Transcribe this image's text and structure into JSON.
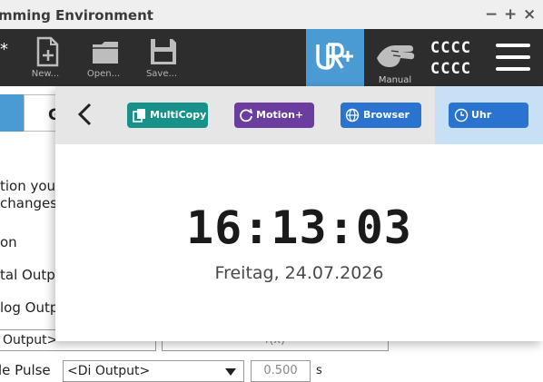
{
  "window": {
    "title": "mming Environment",
    "minimize": "−",
    "maximize": "+",
    "close": "×"
  },
  "toolbar": {
    "modified_marker": "*",
    "new_label": "New...",
    "open_label": "Open...",
    "save_label": "Save...",
    "manual_label": "Manual",
    "robot_line1": "CCCC",
    "robot_line2": "CCCC",
    "colors": {
      "toolbar_bg": "#2d2d2d",
      "urcap_bg": "#4a9ad4"
    }
  },
  "background": {
    "tab_label": "G",
    "lines": [
      "tion you",
      "changes",
      "on",
      "tal Outpu",
      "log Outp"
    ],
    "output_select": "Output>",
    "fx_field": "f(x)",
    "pulse_label": "le Pulse",
    "di_select": "<Di Output>",
    "pulse_value": "0.500",
    "pulse_unit": "s"
  },
  "panel": {
    "back_icon": "chevron-left-icon",
    "chips": [
      {
        "label": "MultiCopy",
        "icon": "copy-icon",
        "color": "#17928a"
      },
      {
        "label": "Motion+",
        "icon": "rotate-icon",
        "color": "#6a3d9e"
      },
      {
        "label": "Browser",
        "icon": "globe-icon",
        "color": "#2a74d0"
      },
      {
        "label": "Uhr",
        "icon": "clock-icon",
        "color": "#2a74d0"
      }
    ],
    "active_chip_bg": "#c7e0f6",
    "time": "16:13:03",
    "date": "Freitag, 24.07.2026"
  }
}
